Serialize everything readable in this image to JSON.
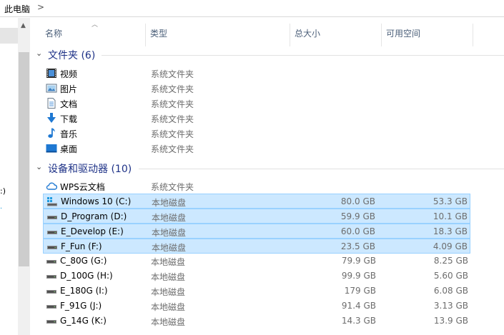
{
  "breadcrumb": {
    "location": "此电脑",
    "separator": ">"
  },
  "columns": {
    "name": "名称",
    "type": "类型",
    "total": "总大小",
    "free": "可用空间"
  },
  "nav_fragments": {
    "frag1": ":)",
    "frag2": "·"
  },
  "groups": {
    "folders": {
      "title": "文件夹 (6)",
      "items": [
        {
          "name": "视频",
          "type": "系统文件夹",
          "icon": "video-folder-icon"
        },
        {
          "name": "图片",
          "type": "系统文件夹",
          "icon": "pictures-folder-icon"
        },
        {
          "name": "文档",
          "type": "系统文件夹",
          "icon": "documents-folder-icon"
        },
        {
          "name": "下载",
          "type": "系统文件夹",
          "icon": "download-folder-icon"
        },
        {
          "name": "音乐",
          "type": "系统文件夹",
          "icon": "music-folder-icon"
        },
        {
          "name": "桌面",
          "type": "系统文件夹",
          "icon": "desktop-folder-icon"
        }
      ]
    },
    "devices": {
      "title": "设备和驱动器 (10)",
      "items": [
        {
          "name": "WPS云文档",
          "type": "系统文件夹",
          "total": "",
          "free": "",
          "icon": "cloud-icon"
        },
        {
          "name": "Windows 10 (C:)",
          "type": "本地磁盘",
          "total": "80.0 GB",
          "free": "53.3 GB",
          "icon": "windows-drive-icon",
          "selected": true
        },
        {
          "name": "D_Program (D:)",
          "type": "本地磁盘",
          "total": "59.9 GB",
          "free": "10.1 GB",
          "icon": "drive-icon",
          "selected": true
        },
        {
          "name": "E_Develop (E:)",
          "type": "本地磁盘",
          "total": "60.0 GB",
          "free": "18.3 GB",
          "icon": "drive-icon",
          "selected": true
        },
        {
          "name": "F_Fun (F:)",
          "type": "本地磁盘",
          "total": "23.5 GB",
          "free": "4.09 GB",
          "icon": "drive-icon",
          "selected": true
        },
        {
          "name": "C_80G (G:)",
          "type": "本地磁盘",
          "total": "79.9 GB",
          "free": "8.25 GB",
          "icon": "drive-icon"
        },
        {
          "name": "D_100G (H:)",
          "type": "本地磁盘",
          "total": "99.9 GB",
          "free": "5.60 GB",
          "icon": "drive-icon"
        },
        {
          "name": "E_180G (I:)",
          "type": "本地磁盘",
          "total": "179 GB",
          "free": "6.08 GB",
          "icon": "drive-icon"
        },
        {
          "name": "F_91G (J:)",
          "type": "本地磁盘",
          "total": "91.4 GB",
          "free": "3.13 GB",
          "icon": "drive-icon"
        },
        {
          "name": "G_14G (K:)",
          "type": "本地磁盘",
          "total": "14.3 GB",
          "free": "13.9 GB",
          "icon": "drive-icon"
        }
      ]
    }
  },
  "colors": {
    "selection": "#cce8ff",
    "selection_border": "#99d1ff",
    "group_title": "#1e3287",
    "header_text": "#4c607a"
  }
}
